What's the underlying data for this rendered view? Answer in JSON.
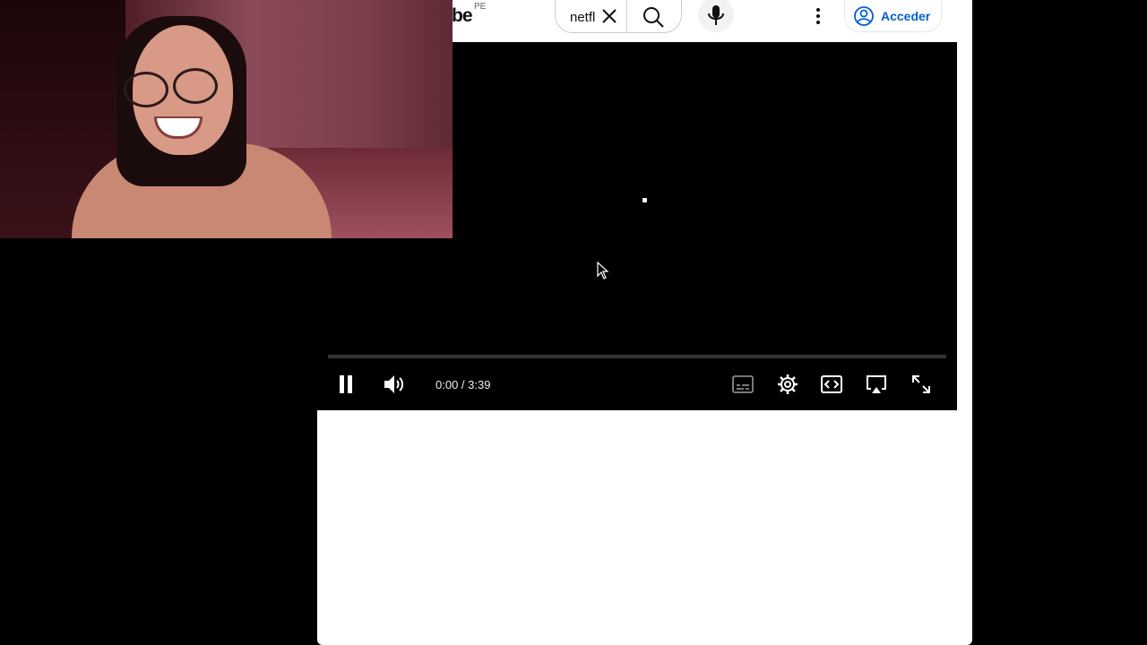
{
  "header": {
    "logo_text": "be",
    "region": "PE",
    "search_value": "netfl",
    "signin_label": "Acceder"
  },
  "player": {
    "current_time": "0:00",
    "duration": "3:39",
    "time_display": "0:00 / 3:39",
    "progress": 0,
    "accent_color": "#ff0000"
  },
  "icons": {
    "clear": "close-icon",
    "search": "search-icon",
    "mic": "microphone-icon",
    "more": "more-vert-icon",
    "account": "account-circle-icon",
    "play_pause": "pause-icon",
    "volume": "volume-icon",
    "subtitles": "subtitles-icon",
    "settings": "gear-icon",
    "theater": "theater-mode-icon",
    "airplay": "airplay-icon",
    "fullscreen": "fullscreen-icon"
  },
  "colors": {
    "link_blue": "#065fd4",
    "player_bg": "#000000"
  }
}
